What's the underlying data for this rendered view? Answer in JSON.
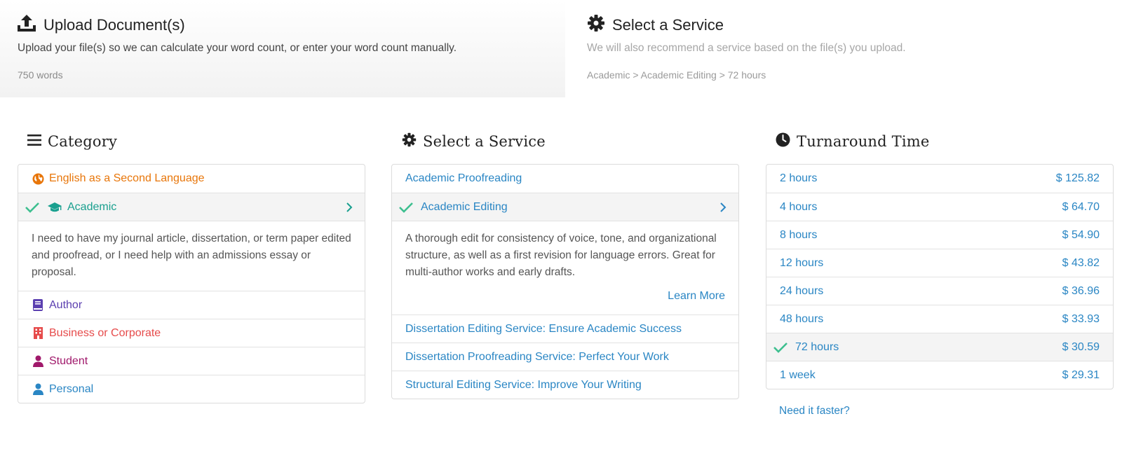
{
  "steps": {
    "upload": {
      "title": "Upload Document(s)",
      "description": "Upload your file(s) so we can calculate your word count, or enter your word count manually.",
      "word_count": "750 words",
      "icon": "upload-icon"
    },
    "service": {
      "title": "Select a Service",
      "description": "We will also recommend a service based on the file(s) you upload.",
      "breadcrumb": "Academic > Academic Editing > 72 hours",
      "icon": "gear-icon"
    }
  },
  "category": {
    "title": "Category",
    "icon": "menu-icon",
    "items": [
      {
        "label": "English as a Second Language",
        "icon": "globe-icon",
        "color": "#e8760a"
      },
      {
        "label": "Academic",
        "icon": "graduation-cap-icon",
        "color": "#1aa08f",
        "selected": true
      },
      {
        "label": "Author",
        "icon": "book-icon",
        "color": "#5b3fb0"
      },
      {
        "label": "Business or Corporate",
        "icon": "building-icon",
        "color": "#e64b4b"
      },
      {
        "label": "Student",
        "icon": "user-icon",
        "color": "#a0196b"
      },
      {
        "label": "Personal",
        "icon": "user-icon",
        "color": "#2a86c4"
      }
    ],
    "selected_description": "I need to have my journal article, dissertation, or term paper edited and proofread, or I need help with an admissions essay or proposal."
  },
  "service": {
    "title": "Select a Service",
    "icon": "gear-icon",
    "items": [
      {
        "label": "Academic Proofreading"
      },
      {
        "label": "Academic Editing",
        "selected": true
      },
      {
        "label": "Dissertation Editing Service: Ensure Academic Success"
      },
      {
        "label": "Dissertation Proofreading Service: Perfect Your Work"
      },
      {
        "label": "Structural Editing Service: Improve Your Writing"
      }
    ],
    "selected_description": "A thorough edit for consistency of voice, tone, and organizational structure, as well as a first revision for language errors. Great for multi-author works and early drafts.",
    "learn_more": "Learn More"
  },
  "turnaround": {
    "title": "Turnaround Time",
    "icon": "clock-icon",
    "items": [
      {
        "label": "2 hours",
        "price": "$ 125.82"
      },
      {
        "label": "4 hours",
        "price": "$ 64.70"
      },
      {
        "label": "8 hours",
        "price": "$ 54.90"
      },
      {
        "label": "12 hours",
        "price": "$ 43.82"
      },
      {
        "label": "24 hours",
        "price": "$ 36.96"
      },
      {
        "label": "48 hours",
        "price": "$ 33.93"
      },
      {
        "label": "72 hours",
        "price": "$ 30.59",
        "selected": true
      },
      {
        "label": "1 week",
        "price": "$ 29.31"
      }
    ],
    "need_faster": "Need it faster?"
  },
  "colors": {
    "link": "#2a86c4",
    "check": "#3dbf8f",
    "selected_bg": "#f4f4f4"
  }
}
